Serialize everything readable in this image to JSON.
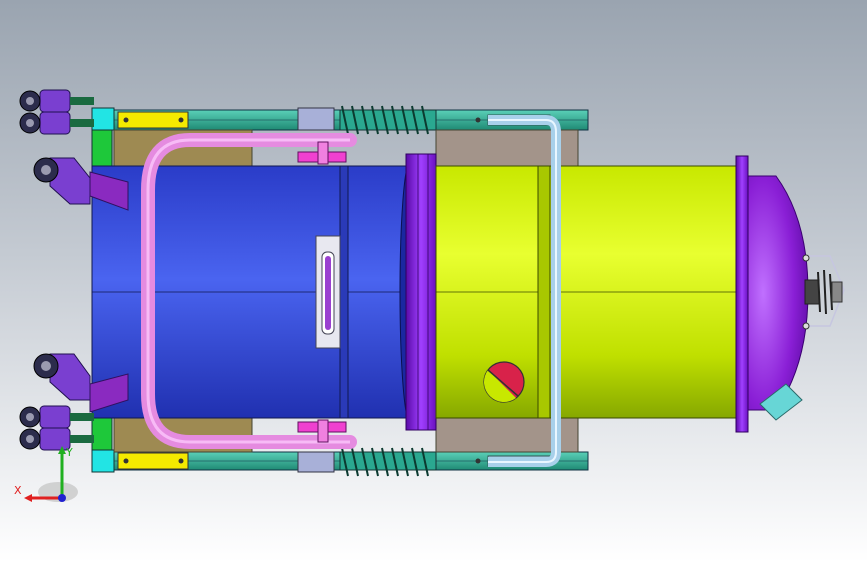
{
  "viewport": {
    "background_top": "#9aa4b0",
    "background_bottom": "#ffffff"
  },
  "model": {
    "colors": {
      "blue_cylinder": "#3a4fd8",
      "yellow_green_cylinder": "#d7f000",
      "purple_dome": "#8a1fd6",
      "teal_rail": "#2aa890",
      "pink_handle": "#e58be0",
      "light_blue_handle": "#a8d0ea",
      "caster_purple": "#7a3fd0",
      "block_yellow": "#f4ea00",
      "block_cyan": "#22e4e4",
      "block_green": "#1ec83a",
      "bracket_tan": "#9e8a52",
      "bracket_gray": "#a3948a",
      "valve_red": "#d8224a",
      "nozzle_cyan": "#67d6d6"
    }
  },
  "triad": {
    "x_label": "X",
    "y_label": "Y",
    "x_color": "#e02020",
    "y_color": "#20b020",
    "z_color": "#2020d0"
  }
}
